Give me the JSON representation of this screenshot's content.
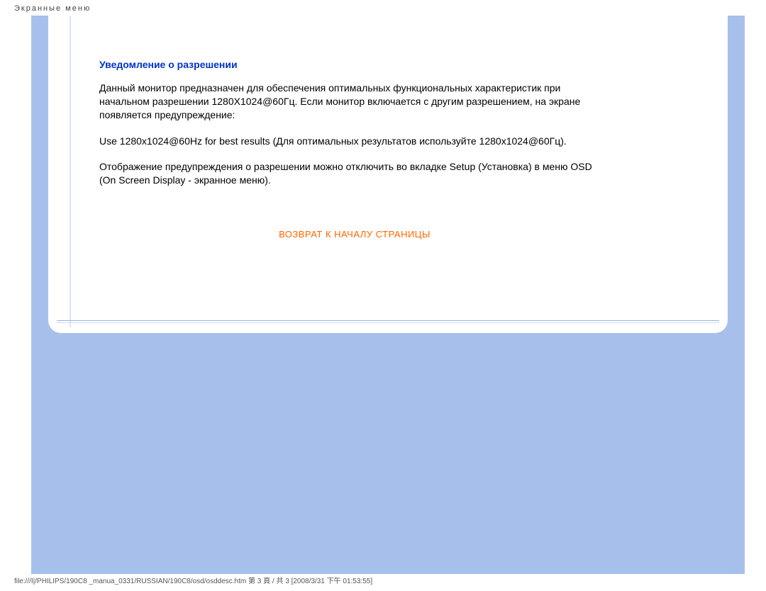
{
  "header": {
    "title": "Экранные меню"
  },
  "content": {
    "section_title": "Уведомление о разрешении",
    "para1": "Данный монитор предназначен для обеспечения оптимальных функциональных характеристик при начальном разрешении 1280X1024@60Гц. Если монитор включается с другим разрешением, на экране появляется предупреждение:",
    "para2": "Use 1280x1024@60Hz for best results (Для оптимальных результатов используйте 1280x1024@60Гц).",
    "para3": "Отображение предупреждения о разрешении можно отключить во вкладке Setup (Установка) в меню OSD (On Screen Display - экранное меню).",
    "return_link": "ВОЗВРАТ К НАЧАЛУ СТРАНИЦЫ"
  },
  "footer": {
    "path": "file:///I|/PHILIPS/190C8 _manua_0331/RUSSIAN/190C8/osd/osddesc.htm 第 3 頁 / 共 3  [2008/3/31 下午 01:53:55]"
  }
}
